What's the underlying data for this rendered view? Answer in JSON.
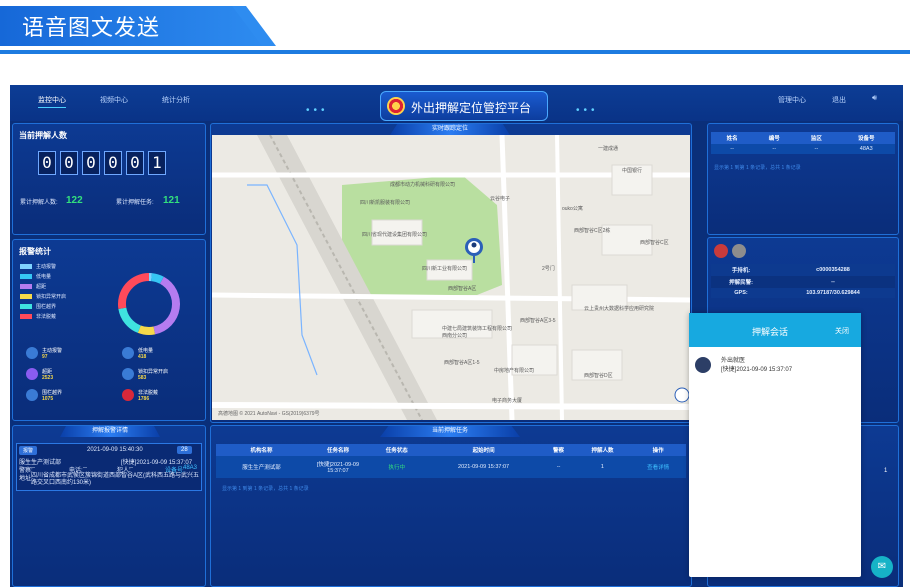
{
  "banner": {
    "title": "语音图文发送"
  },
  "nav": {
    "items": [
      "监控中心",
      "视频中心",
      "统计分析"
    ],
    "right": [
      "管理中心",
      "退出"
    ],
    "app_title": "外出押解定位管控平台"
  },
  "current_count": {
    "title": "当前押解人数",
    "digits": [
      "0",
      "0",
      "0",
      "0",
      "0",
      "1"
    ],
    "total_people_label": "累计押解人数:",
    "total_people": "122",
    "total_tasks_label": "累计押解任务:",
    "total_tasks": "121"
  },
  "alarm_stats": {
    "title": "报警统计",
    "legend": [
      {
        "label": "主动报警",
        "color": "#7fd3ff"
      },
      {
        "label": "低电量",
        "color": "#36c6f4"
      },
      {
        "label": "超距",
        "color": "#b57cf0"
      },
      {
        "label": "锁扣异常开启",
        "color": "#f6d94a"
      },
      {
        "label": "围栏越界",
        "color": "#3fe3e0"
      },
      {
        "label": "非法脱戴",
        "color": "#ff4a5a"
      }
    ],
    "donut": [
      {
        "value": 97,
        "color": "#7fd3ff"
      },
      {
        "value": 418,
        "color": "#36c6f4"
      },
      {
        "value": 2523,
        "color": "#b57cf0"
      },
      {
        "value": 583,
        "color": "#f6d94a"
      },
      {
        "value": 1075,
        "color": "#3fe3e0"
      },
      {
        "value": 1786,
        "color": "#ff4a5a"
      }
    ],
    "items": [
      {
        "label": "主动报警",
        "value": "97",
        "color": "#3a7bd5"
      },
      {
        "label": "低电量",
        "value": "418",
        "color": "#3a7bd5"
      },
      {
        "label": "超距",
        "value": "2523",
        "color": "#8a5cf0"
      },
      {
        "label": "锁扣异常开启",
        "value": "583",
        "color": "#3a7bd5"
      },
      {
        "label": "围栏越界",
        "value": "1075",
        "color": "#3a7bd5"
      },
      {
        "label": "非法脱戴",
        "value": "1786",
        "color": "#d8283a"
      }
    ]
  },
  "map": {
    "header": "实时跟踪定位",
    "labels": [
      "成都市动力机械科研有限公司",
      "四川省现代建设集团有限公司",
      "云谷电子",
      "四川新工业有限公司",
      "西部智谷A区",
      "西部智谷C区2栋",
      "中国银行",
      "ouko公寓",
      "西部智谷C区",
      "中建七局建筑装饰工程有限公司西南分公司",
      "西部智谷A区3-5",
      "云上贵州大数据科学应用研究院",
      "西部智谷A区1-5",
      "中房地产有限公司",
      "西部智谷D区",
      "电子商务大厦",
      "2号门",
      "一建成通",
      "四川新凯服装有限公司"
    ],
    "copyright": "高德地图 © 2021 AutoNavi - GS(2019)6379号"
  },
  "right_table": {
    "headers": [
      "姓名",
      "编号",
      "监区",
      "设备号"
    ],
    "row": [
      "--",
      "--",
      "--",
      "48A3"
    ],
    "pager": "显示第 1 到第 1 条记录，总共 1 条记录"
  },
  "device_info": {
    "rows": [
      {
        "label": "手持机:",
        "value": "c0000354288"
      },
      {
        "label": "押解民警:",
        "value": "--"
      },
      {
        "label": "GPS:",
        "value": "103.97187/30.629844"
      }
    ]
  },
  "task_detail": {
    "header": "押解报警详情",
    "badge": "报警",
    "time": "2021-09-09 15:40:30",
    "count": "28",
    "org": "服生生产测试部",
    "task": "[快捷]2021-09-09 15:37:07",
    "police_label": "警察:",
    "police": "--",
    "phone_label": "电话:",
    "phone": "--",
    "criminal_label": "犯人:",
    "criminal": "--",
    "device_label": "设备号:",
    "device": "48A3",
    "address_label": "地址:",
    "address": "四川省成都市武侯区簇锦街道西部智谷A区(武科西五路与武兴五路交叉口西南约130米)"
  },
  "current_tasks": {
    "header": "当前押解任务",
    "headers": [
      "机构名称",
      "任务名称",
      "任务状态",
      "起始时间",
      "警察",
      "押解人数",
      "操作"
    ],
    "row": [
      "服生生产测试部",
      "[快捷]2021-09-09 15:37:07",
      "执行中",
      "2021-09-09 15:37:07",
      "--",
      "1",
      "查看详情"
    ],
    "pager": "显示第 1 到第 1 条记录，总共 1 条记录"
  },
  "side_value": "1",
  "chat": {
    "title": "押解会话",
    "close": "关闭",
    "sender": "外出就医",
    "message": "[快捷]2021-09-09 15:37:07"
  }
}
